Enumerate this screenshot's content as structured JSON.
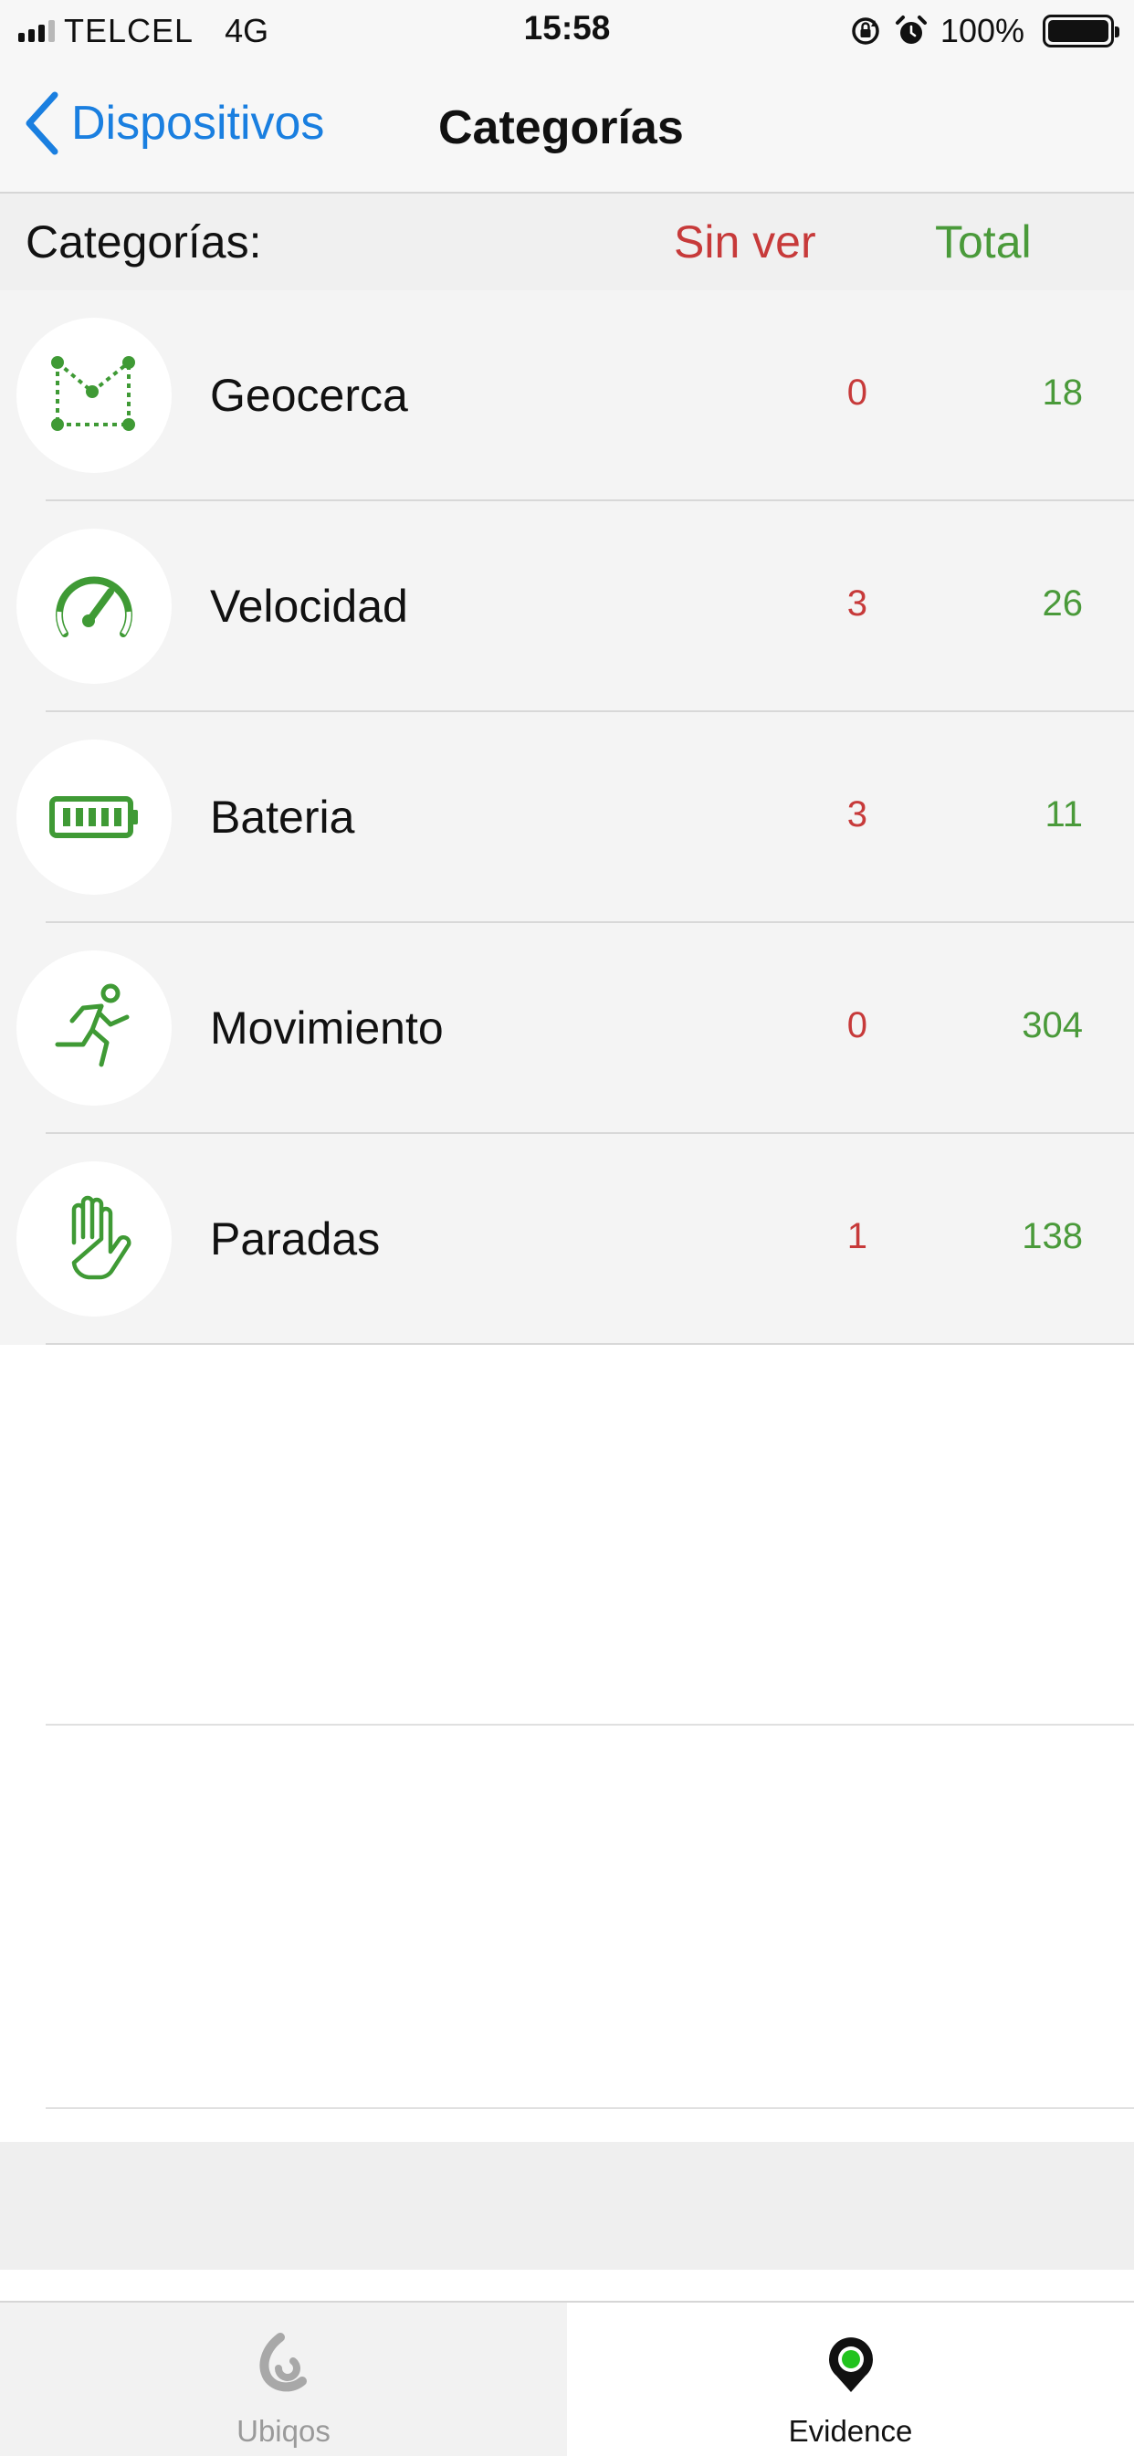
{
  "status_bar": {
    "carrier": "TELCEL",
    "network": "4G",
    "time": "15:58",
    "battery": "100%"
  },
  "nav": {
    "back_label": "Dispositivos",
    "title": "Categorías"
  },
  "header": {
    "label": "Categorías:",
    "unseen": "Sin ver",
    "total": "Total"
  },
  "colors": {
    "accent_blue": "#1a7fe0",
    "unseen_red": "#c73a3a",
    "total_green": "#4a9a3a",
    "icon_green": "#3f9a35"
  },
  "categories": [
    {
      "name": "Geocerca",
      "icon": "geofence-icon",
      "unseen": "0",
      "total": "18"
    },
    {
      "name": "Velocidad",
      "icon": "speedometer-icon",
      "unseen": "3",
      "total": "26"
    },
    {
      "name": "Bateria",
      "icon": "battery-icon",
      "unseen": "3",
      "total": "11"
    },
    {
      "name": "Movimiento",
      "icon": "running-person-icon",
      "unseen": "0",
      "total": "304"
    },
    {
      "name": "Paradas",
      "icon": "stop-hand-icon",
      "unseen": "1",
      "total": "138"
    }
  ],
  "tabs": [
    {
      "label": "Ubiqos",
      "icon": "ubiqos-logo-icon",
      "selected": false
    },
    {
      "label": "Evidence",
      "icon": "evidence-logo-icon",
      "selected": true
    }
  ]
}
